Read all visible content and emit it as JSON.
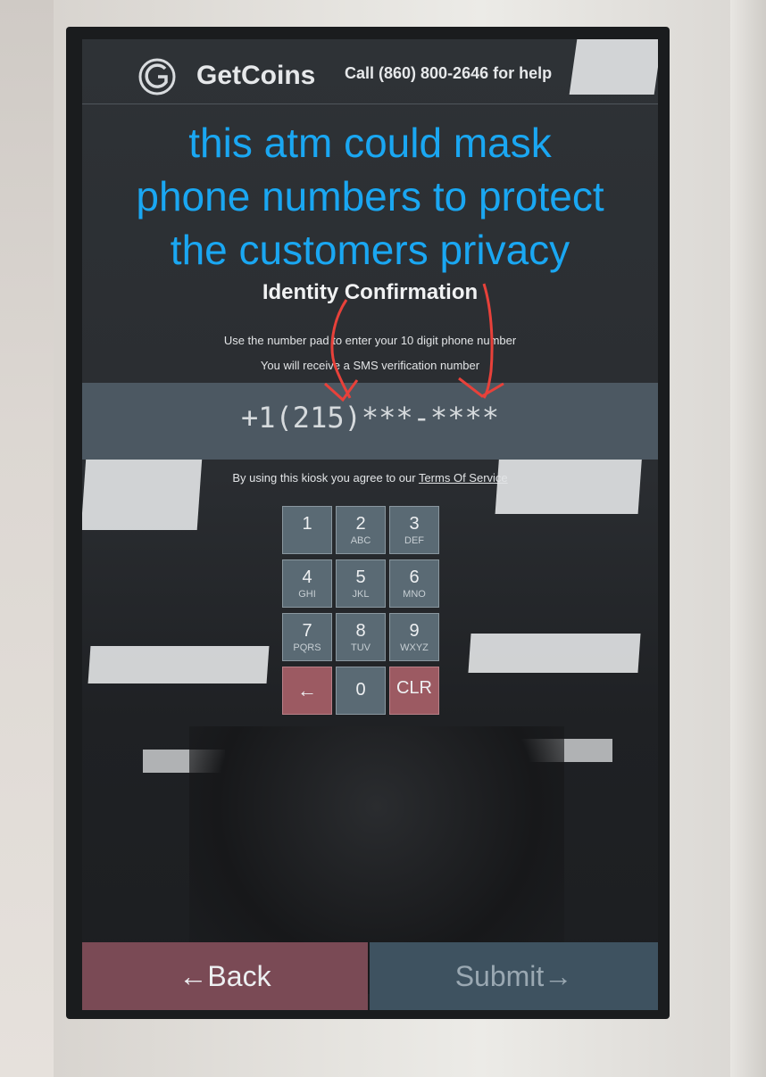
{
  "header": {
    "brand": "GetCoins",
    "help_text": "Call (860) 800-2646  for help"
  },
  "overlay_caption": {
    "line1": "this atm could mask",
    "line2": "phone numbers to protect",
    "line3": "the customers privacy",
    "color": "#1aa7f2"
  },
  "main": {
    "title": "Identity Confirmation",
    "instruction1": "Use the number pad to enter your 10 digit phone number",
    "instruction2": "You will receive a SMS verification number",
    "phone_value": "+1(215)***-****",
    "terms_prefix": "By using this kiosk you agree to our ",
    "terms_link": "Terms Of Service"
  },
  "keypad": {
    "keys": [
      {
        "digit": "1",
        "letters": ""
      },
      {
        "digit": "2",
        "letters": "ABC"
      },
      {
        "digit": "3",
        "letters": "DEF"
      },
      {
        "digit": "4",
        "letters": "GHI"
      },
      {
        "digit": "5",
        "letters": "JKL"
      },
      {
        "digit": "6",
        "letters": "MNO"
      },
      {
        "digit": "7",
        "letters": "PQRS"
      },
      {
        "digit": "8",
        "letters": "TUV"
      },
      {
        "digit": "9",
        "letters": "WXYZ"
      }
    ],
    "backspace_icon": "arrow-left-icon",
    "zero": "0",
    "clear": "CLR"
  },
  "footer": {
    "back_label": "←Back",
    "submit_label": "Submit→"
  },
  "colors": {
    "annotation_arrow": "#e8413a",
    "back_button": "#7a4a55",
    "submit_button": "#3e5260"
  }
}
